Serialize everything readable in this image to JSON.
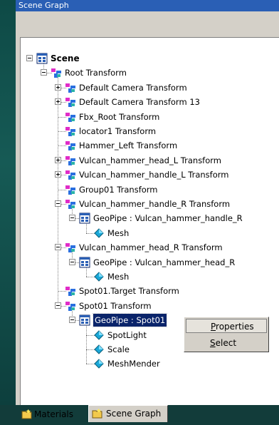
{
  "window": {
    "title": "Scene Graph"
  },
  "tree": [
    {
      "label": "Scene",
      "icon": "scene-icon",
      "expander": "minus",
      "bold": true
    },
    {
      "label": "Root Transform",
      "icon": "transform-icon",
      "expander": "minus"
    },
    {
      "label": "Default Camera Transform",
      "icon": "transform-icon",
      "expander": "plus"
    },
    {
      "label": "Default Camera Transform 13",
      "icon": "transform-icon",
      "expander": "plus"
    },
    {
      "label": "Fbx_Root Transform",
      "icon": "transform-icon",
      "expander": "none"
    },
    {
      "label": "locator1 Transform",
      "icon": "transform-icon",
      "expander": "none"
    },
    {
      "label": "Hammer_Left Transform",
      "icon": "transform-icon",
      "expander": "none"
    },
    {
      "label": "Vulcan_hammer_head_L Transform",
      "icon": "transform-icon",
      "expander": "plus"
    },
    {
      "label": "Vulcan_hammer_handle_L Transform",
      "icon": "transform-icon",
      "expander": "plus"
    },
    {
      "label": "Group01 Transform",
      "icon": "transform-icon",
      "expander": "none"
    },
    {
      "label": "Vulcan_hammer_handle_R Transform",
      "icon": "transform-icon",
      "expander": "minus"
    },
    {
      "label": "GeoPipe : Vulcan_hammer_handle_R",
      "icon": "geopipe-icon",
      "expander": "minus"
    },
    {
      "label": "Mesh",
      "icon": "mesh-icon",
      "expander": "none"
    },
    {
      "label": "Vulcan_hammer_head_R Transform",
      "icon": "transform-icon",
      "expander": "minus"
    },
    {
      "label": "GeoPipe : Vulcan_hammer_head_R",
      "icon": "geopipe-icon",
      "expander": "minus"
    },
    {
      "label": "Mesh",
      "icon": "mesh-icon",
      "expander": "none"
    },
    {
      "label": "Spot01.Target Transform",
      "icon": "transform-icon",
      "expander": "none"
    },
    {
      "label": "Spot01 Transform",
      "icon": "transform-icon",
      "expander": "minus"
    },
    {
      "label": "GeoPipe : Spot01",
      "icon": "geopipe-icon",
      "expander": "minus",
      "selected": true
    },
    {
      "label": "SpotLight",
      "icon": "mesh-icon",
      "expander": "none"
    },
    {
      "label": "Scale",
      "icon": "mesh-icon",
      "expander": "none"
    },
    {
      "label": "MeshMender",
      "icon": "mesh-icon",
      "expander": "none"
    }
  ],
  "context_menu": {
    "items": [
      {
        "label": "Properties",
        "accelerator": "P",
        "highlighted": true
      },
      {
        "label": "Select",
        "accelerator": "S",
        "highlighted": false
      }
    ]
  },
  "tabs": [
    {
      "label": "Materials",
      "icon": "materials-icon",
      "active": false
    },
    {
      "label": "Scene Graph",
      "icon": "scene-graph-tab-icon",
      "active": true
    }
  ],
  "colors": {
    "selection": "#0a246a",
    "titlebar": "#2a5fb5",
    "transform_magenta": "#e02cc8",
    "transform_blue": "#2a6fe0",
    "mesh_cyan": "#1aa8d8"
  }
}
